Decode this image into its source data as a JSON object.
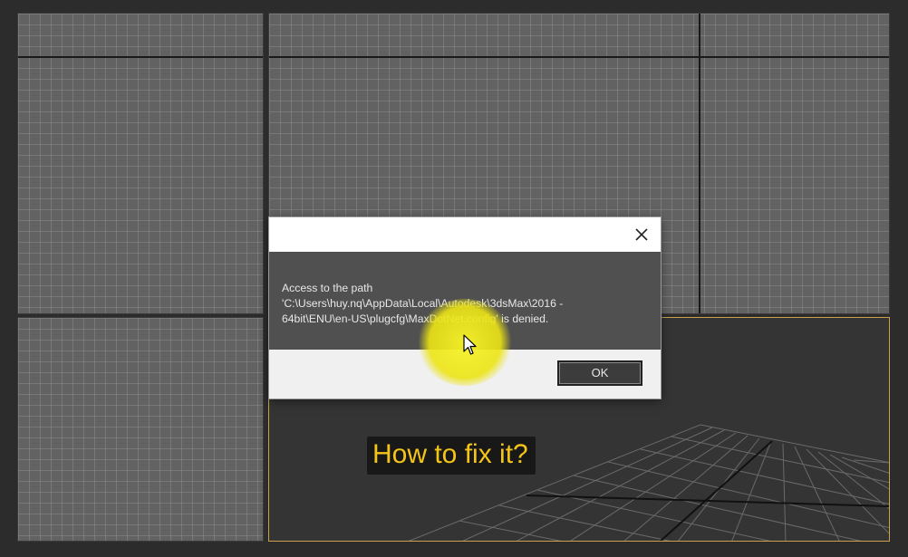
{
  "dialog": {
    "message_line1": "Access to the path",
    "message_line2": "'C:\\Users\\huy.nq\\AppData\\Local\\Autodesk\\3dsMax\\2016 -",
    "message_line3": "64bit\\ENU\\en-US\\plugcfg\\MaxDotNet.config' is denied.",
    "ok_label": "OK",
    "close_icon": "close-icon"
  },
  "caption": {
    "text": "How to fix it?"
  },
  "colors": {
    "background": "#2c2c2c",
    "viewport_grid": "#626262",
    "active_viewport_border": "#c8a24a",
    "dialog_body": "#505050",
    "caption_text": "#f4c518",
    "cursor_highlight": "#f0e820"
  }
}
